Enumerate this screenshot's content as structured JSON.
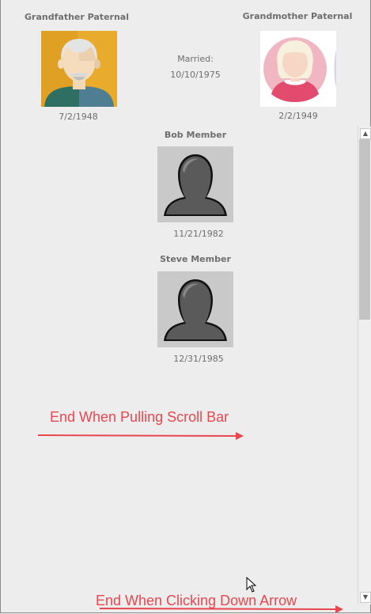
{
  "grandfather": {
    "title": "Grandfather Paternal",
    "date": "7/2/1948",
    "photo_icon": "grandfather-avatar-icon"
  },
  "grandmother": {
    "title": "Grandmother Paternal",
    "date": "2/2/1949",
    "photo_icon": "grandmother-avatar-icon"
  },
  "marriage": {
    "label": "Married:",
    "date": "10/10/1975"
  },
  "children": [
    {
      "name": "Bob Member",
      "date": "11/21/1982",
      "photo_icon": "silhouette-avatar-icon"
    },
    {
      "name": "Steve Member",
      "date": "12/31/1985",
      "photo_icon": "silhouette-avatar-icon"
    }
  ],
  "scrollbar": {
    "up_glyph": "▲",
    "down_glyph": "▼"
  },
  "annotations": {
    "scroll_bar_note": "End When Pulling Scroll Bar",
    "down_arrow_note": "End When Clicking Down Arrow",
    "color": "#e8474f"
  }
}
